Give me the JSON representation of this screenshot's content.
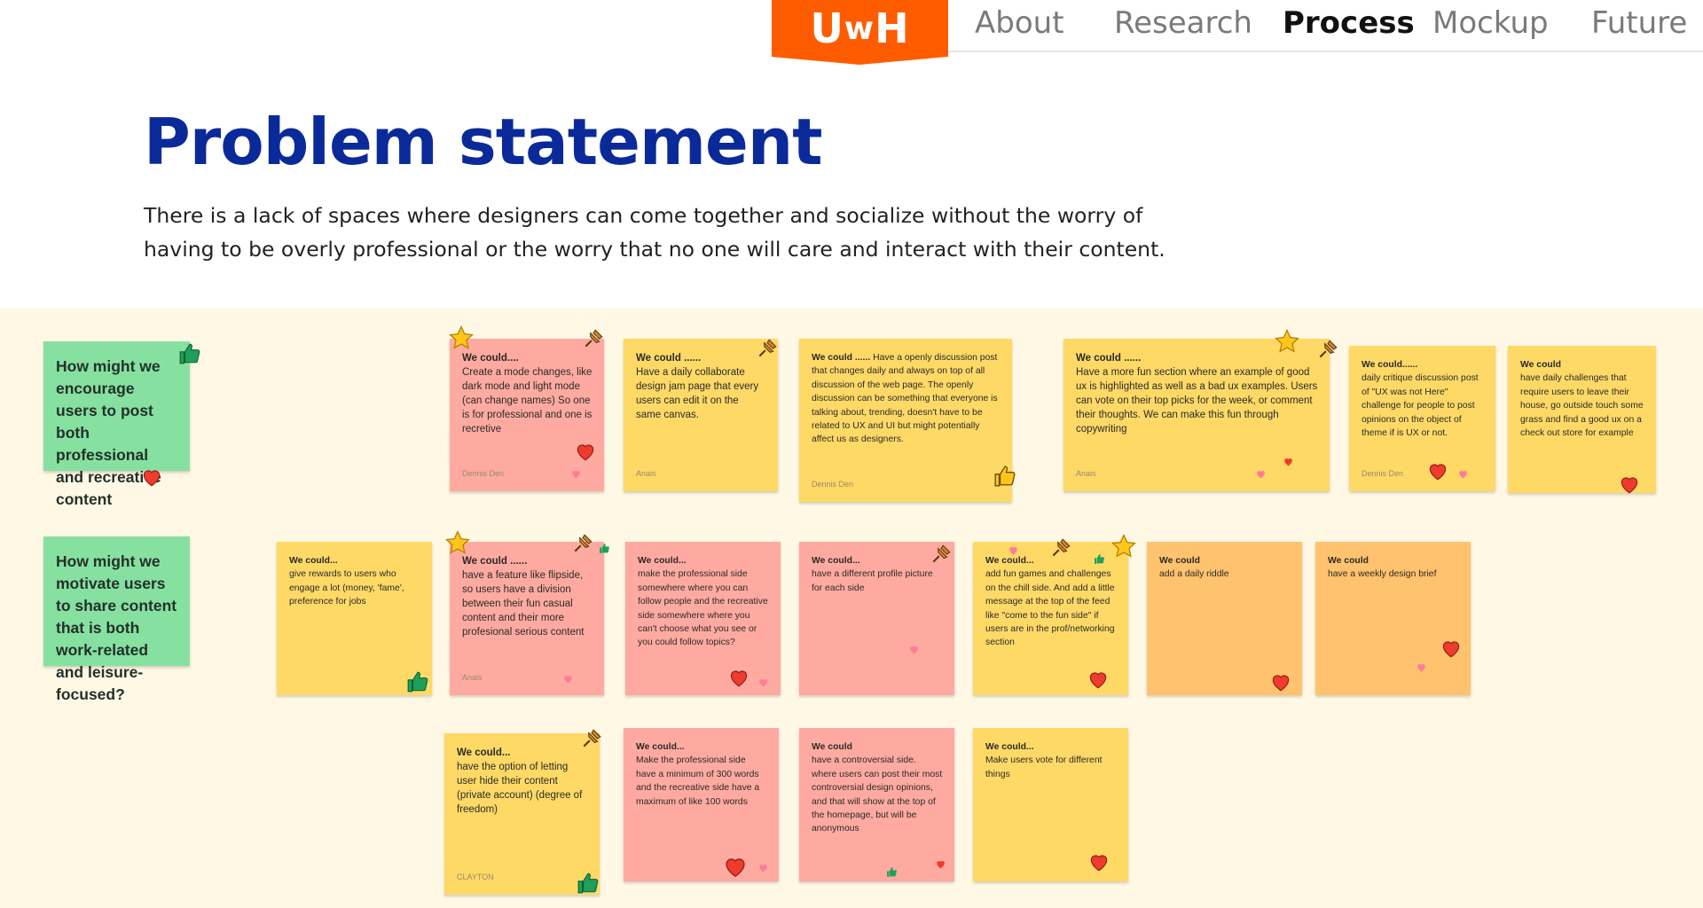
{
  "nav": {
    "logo_main": "U",
    "logo_small": "w",
    "logo_end": "H",
    "items": [
      {
        "label": "About"
      },
      {
        "label": "Research"
      },
      {
        "label": "Process"
      },
      {
        "label": "Mockup"
      },
      {
        "label": "Future"
      }
    ],
    "active": "Process",
    "brand_color": "#ff5c00"
  },
  "header": {
    "title": "Problem statement",
    "description": "There is a lack of spaces where designers can come together and socialize without the worry of having to be overly professional or the worry that no one will care and interact with their content.",
    "title_color": "#0b2a9a"
  },
  "board": {
    "background": "#fff8e4",
    "hmw": [
      {
        "text": "How might we encourage users to post both professional and recreative content"
      },
      {
        "text": "How might we motivate users to share content that is both work-related and leisure-focused?"
      }
    ],
    "notes": [
      {
        "head": "We could....",
        "body": "Create a mode changes, like dark mode and light mode (can change names) So one is for professional and one is recretive",
        "author": "Dennis Den"
      },
      {
        "head": "We could ......",
        "body": "Have a daily collaborate design jam page that every users can edit it on the same canvas.",
        "author": "Anais"
      },
      {
        "head": "We could ......",
        "body": "Have a openly discussion post that changes daily and always on top of all discussion of the web page. The openly discussion can be something that everyone is talking about, trending, doesn't have to be related to UX and UI but might potentially affect us as designers.",
        "author": "Dennis Den"
      },
      {
        "head": "We could ......",
        "body": "Have a more fun section where an  example of good ux is highlighted as well as a bad ux examples. Users can vote on their top picks for the week, or comment their thoughts. We can make this fun through copywriting",
        "author": "Anais"
      },
      {
        "head": "We could......",
        "body": "daily critique discussion post of \"UX was not Here\" challenge for people to post opinions on the object of theme if is UX or not.",
        "author": "Dennis Den"
      },
      {
        "head": "We could",
        "body": "have daily challenges that require users to leave their house, go outside touch some grass and find a good ux on a check out store for example",
        "author": ""
      },
      {
        "head": "We could...",
        "body": "give rewards to users who engage a lot (money, 'fame', preference for jobs",
        "author": ""
      },
      {
        "head": "We could ......",
        "body": "have a feature like flipside, so users have a division between their fun casual content and their more profesional serious content",
        "author": "Anais"
      },
      {
        "head": "We could...",
        "body": "make the professional side somewhere where you can follow people and the recreative side somewhere where you can't choose what you see or you could follow topics?",
        "author": ""
      },
      {
        "head": "We could...",
        "body": "have a different profile picture for each side",
        "author": ""
      },
      {
        "head": "We could...",
        "body": "add fun games and challenges on the chill side. And add a little message at the top of the feed like \"come to the fun side\" if users are in the prof/networking section",
        "author": ""
      },
      {
        "head": "We could",
        "body": "add a daily riddle",
        "author": ""
      },
      {
        "head": "We could",
        "body": "have a weekly design brief",
        "author": ""
      },
      {
        "head": "We could...",
        "body": "have the option of letting user hide their content (private account) (degree of freedom)",
        "author": "CLAYTON"
      },
      {
        "head": "We could...",
        "body": "Make the professional side have a minimum of 300 words and the recreative side have a maximum of like 100 words",
        "author": ""
      },
      {
        "head": "We could",
        "body": "have a controversial side. where users can post their most controversial design opinions, and that will show at the top of the homepage, but will be anonymous",
        "author": ""
      },
      {
        "head": "We could...",
        "body": "Make users vote for different things",
        "author": ""
      }
    ],
    "colors": {
      "pink": "#ffaaa0",
      "yellow": "#ffd966",
      "orange": "#ffc26e",
      "green": "#86e1a1"
    }
  }
}
